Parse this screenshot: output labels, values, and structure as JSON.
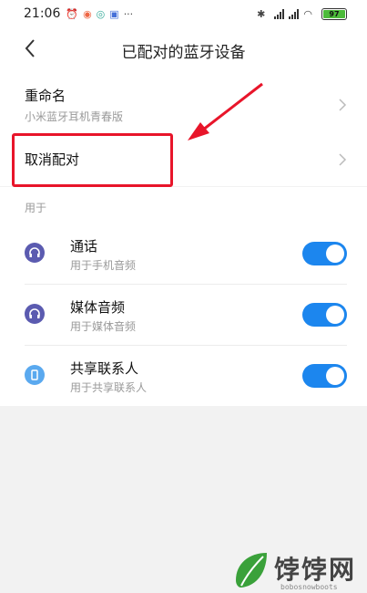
{
  "status_bar": {
    "time": "21:06",
    "battery": "97"
  },
  "header": {
    "title": "已配对的蓝牙设备"
  },
  "device": {
    "rename_label": "重命名",
    "device_name": "小米蓝牙耳机青春版",
    "unpair_label": "取消配对"
  },
  "used_for": {
    "section_label": "用于",
    "items": [
      {
        "label": "通话",
        "sub": "用于手机音频",
        "icon": "headset-icon",
        "enabled": true
      },
      {
        "label": "媒体音频",
        "sub": "用于媒体音频",
        "icon": "headphones-icon",
        "enabled": true
      },
      {
        "label": "共享联系人",
        "sub": "用于共享联系人",
        "icon": "phone-icon",
        "enabled": true
      }
    ]
  },
  "watermark": {
    "brand": "饽饽网",
    "url": "bobosnowboots"
  },
  "colors": {
    "accent": "#1c86ee",
    "highlight": "#e8152a",
    "icon_purple": "#5b5bb0",
    "icon_blue": "#5aa9ef"
  }
}
